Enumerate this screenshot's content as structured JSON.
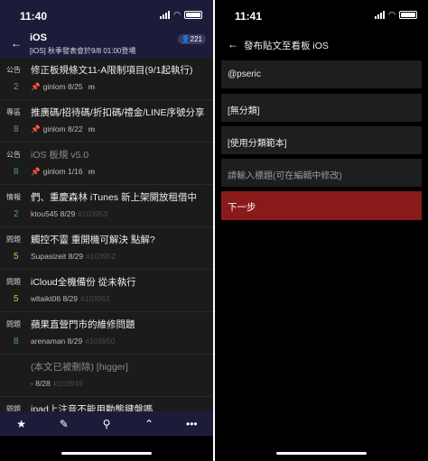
{
  "left": {
    "status_time": "11:40",
    "header": {
      "title": "iOS",
      "subtitle": "[iOS] 秋季發表會於9/8 01:00登場",
      "online_count": "221",
      "back_icon": "arrow-left-icon",
      "online_icon": "user-icon"
    },
    "posts": [
      {
        "category": "公告",
        "count": "2",
        "count_color": "#4caf50",
        "title": "修正板規條文11-A限制項目(9/1起執行)",
        "pinned": true,
        "author": "ginlom",
        "date": "8/25",
        "number": "",
        "more": "m",
        "dim": false
      },
      {
        "category": "專區",
        "count": "8",
        "count_color": "#4caf50",
        "title": "推廣碼/招待碼/折扣碼/禮金/LINE序號分享",
        "pinned": true,
        "author": "ginlom",
        "date": "8/22",
        "number": "",
        "more": "m",
        "dim": false
      },
      {
        "category": "公告",
        "count": "8",
        "count_color": "#4caf50",
        "title": "iOS 板規 v5.0",
        "pinned": true,
        "author": "ginlom",
        "date": "1/16",
        "number": "",
        "more": "m",
        "dim": true
      },
      {
        "category": "情報",
        "count": "2",
        "count_color": "#4caf50",
        "title": "們、重慶森林 iTunes 新上架開放租借中",
        "pinned": false,
        "author": "ktou545",
        "date": "8/29",
        "number": "#103953",
        "more": "",
        "dim": false
      },
      {
        "category": "問題",
        "count": "5",
        "count_color": "#d4c23a",
        "title": "觸控不靈 重開機可解決 點解?",
        "pinned": false,
        "author": "Supasizeit",
        "date": "8/29",
        "number": "#103952",
        "more": "",
        "dim": false
      },
      {
        "category": "問題",
        "count": "5",
        "count_color": "#d4c23a",
        "title": "iCloud全機備份 從未執行",
        "pinned": false,
        "author": "wltaikt06",
        "date": "8/29",
        "number": "#103951",
        "more": "",
        "dim": false
      },
      {
        "category": "問題",
        "count": "8",
        "count_color": "#4caf50",
        "title": "蘋果直營門市的維修問題",
        "pinned": false,
        "author": "arenaman",
        "date": "8/29",
        "number": "#103950",
        "more": "",
        "dim": false
      },
      {
        "category": "",
        "count": "",
        "count_color": "#4caf50",
        "title": "(本文已被刪除) [higger]",
        "pinned": false,
        "author": "-",
        "date": "8/28",
        "number": "#103949",
        "more": "",
        "dim": true
      },
      {
        "category": "問題",
        "count": "",
        "count_color": "#4caf50",
        "title": "ipad上注音不能用動態鍵盤嗎",
        "pinned": false,
        "author": "",
        "date": "",
        "number": "",
        "more": "",
        "dim": false
      }
    ],
    "toolbar": [
      {
        "name": "star-icon",
        "glyph": "★"
      },
      {
        "name": "compose-icon",
        "glyph": "✎"
      },
      {
        "name": "search-icon",
        "glyph": "⚲"
      },
      {
        "name": "chevron-up-icon",
        "glyph": "⌃"
      },
      {
        "name": "more-icon",
        "glyph": "•••"
      }
    ]
  },
  "right": {
    "status_time": "11:41",
    "header": {
      "title": "發布貼文至看板 iOS",
      "back_icon": "arrow-left-icon"
    },
    "fields": {
      "account": "@pseric",
      "category": "[無分類]",
      "template": "[使用分類範本]",
      "title_placeholder": "請輸入標題(可在編輯中修改)"
    },
    "next_label": "下一步",
    "accent_color": "#8a1a1a"
  }
}
